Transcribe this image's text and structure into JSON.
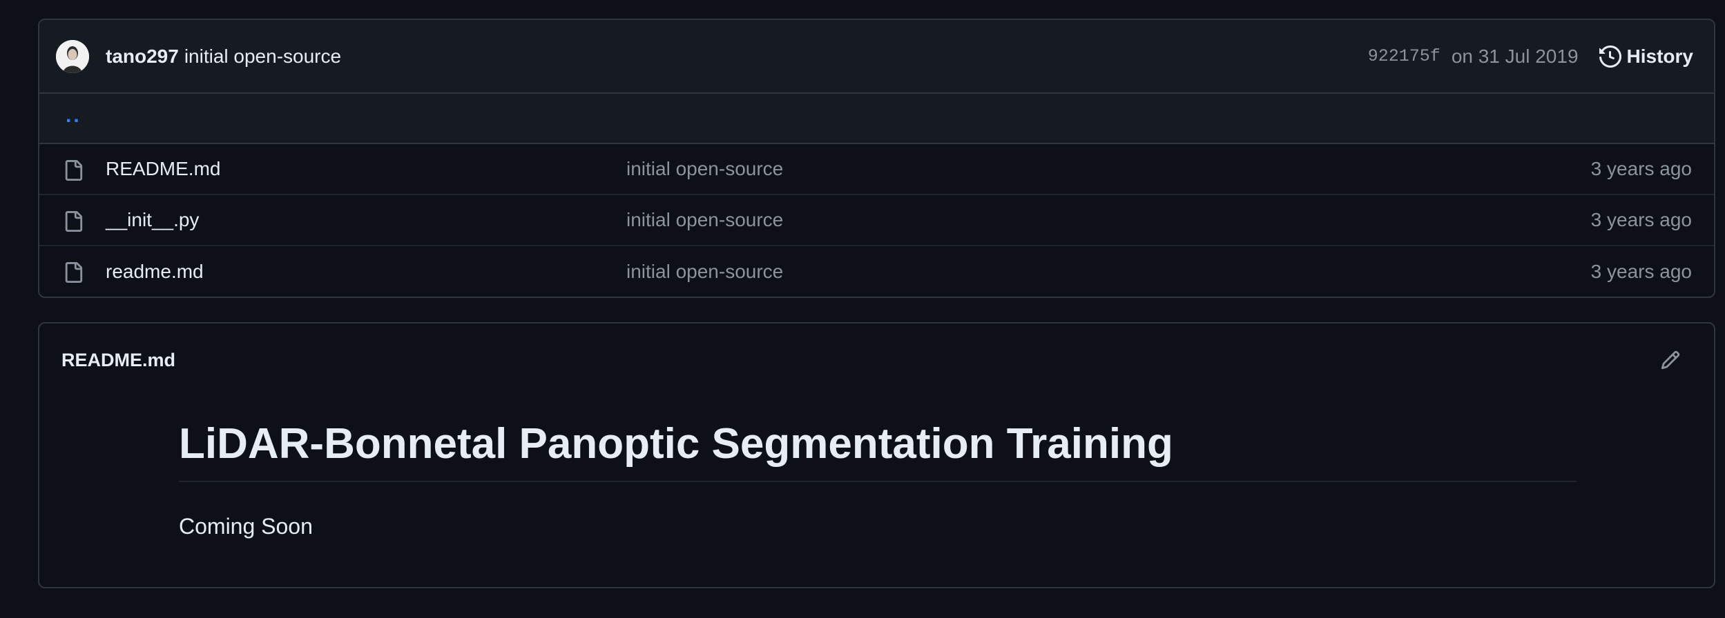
{
  "commit": {
    "author": "tano297",
    "message": "initial open-source",
    "sha": "922175f",
    "date": "on 31 Jul 2019",
    "history_label": "History"
  },
  "parent_dir": "..",
  "files": [
    {
      "name": "README.md",
      "commit": "initial open-source",
      "age": "3 years ago",
      "icon": "file-icon"
    },
    {
      "name": "__init__.py",
      "commit": "initial open-source",
      "age": "3 years ago",
      "icon": "file-icon"
    },
    {
      "name": "readme.md",
      "commit": "initial open-source",
      "age": "3 years ago",
      "icon": "file-icon"
    }
  ],
  "readme": {
    "filename": "README.md",
    "heading": "LiDAR-Bonnetal Panoptic Segmentation Training",
    "body": "Coming Soon"
  },
  "colors": {
    "background": "#0d1117",
    "header_bg": "#161b22",
    "border": "#30363d",
    "link": "#2f81f7",
    "muted": "#8b949e",
    "text": "#e6edf3"
  }
}
